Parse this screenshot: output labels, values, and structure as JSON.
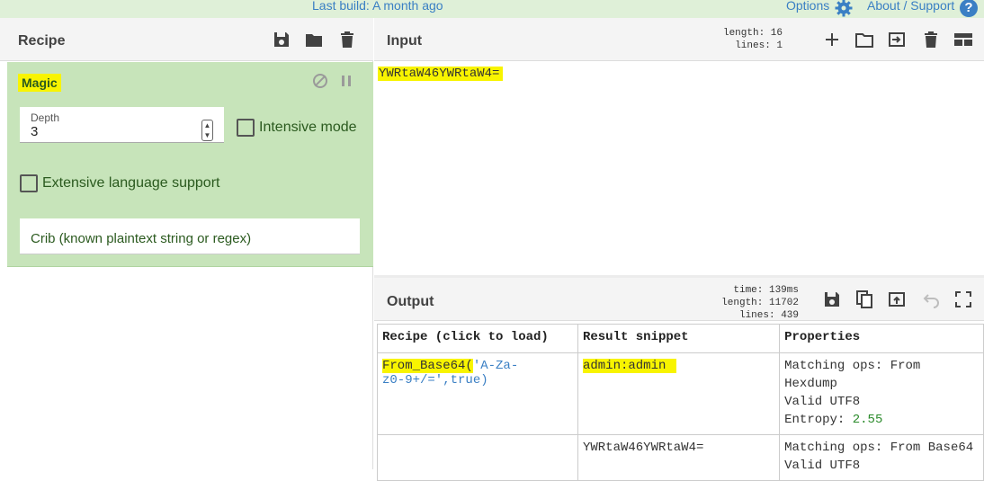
{
  "topbar": {
    "build": "Last build: A month ago",
    "options": "Options",
    "about": "About / Support",
    "about_icon": "?"
  },
  "recipe": {
    "title": "Recipe",
    "operation": {
      "name": "Magic",
      "depth_label": "Depth",
      "depth_value": "3",
      "intensive_label": "Intensive mode",
      "extensive_label": "Extensive language support",
      "crib_placeholder": "Crib (known plaintext string or regex)"
    }
  },
  "input": {
    "title": "Input",
    "length_line": "length: 16",
    "lines_line": "lines:  1",
    "text": "YWRtaW46YWRtaW4="
  },
  "output": {
    "title": "Output",
    "time_line": "time: 139ms",
    "length_line": "length: 11702",
    "lines_line": "lines:   439",
    "table": {
      "headers": [
        "Recipe (click to load)",
        "Result snippet",
        "Properties"
      ],
      "rows": [
        {
          "recipe_a": "From_Base64(",
          "recipe_b": "'A-Za-",
          "recipe_c": "z0-9+/=',true)",
          "snippet": "admin:admin",
          "prop1": "Matching ops: From",
          "prop2": "Hexdump",
          "prop3": "Valid UTF8",
          "prop4_label": "Entropy: ",
          "prop4_value": "2.55"
        },
        {
          "snippet": "YWRtaW46YWRtaW4=",
          "prop1": "Matching ops: From Base64",
          "prop2": "Valid UTF8"
        }
      ]
    }
  },
  "colors": {
    "accent": "#3a7fc4",
    "highlight": "#f8f400",
    "recipe_op_bg": "#c7e4ba",
    "topbar_bg": "#dff0d8"
  }
}
